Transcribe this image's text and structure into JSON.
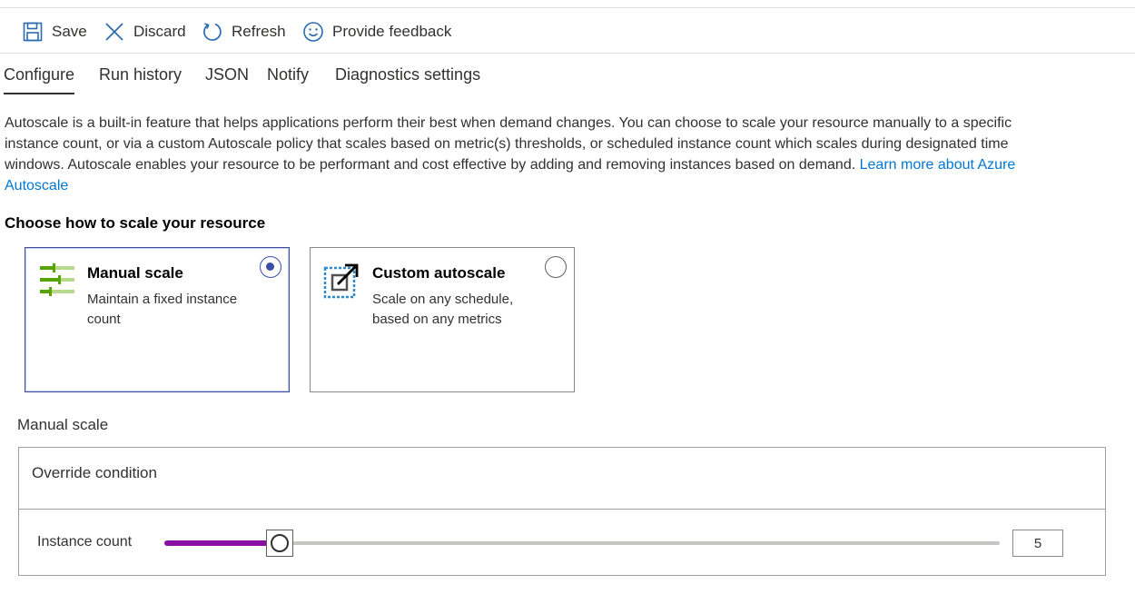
{
  "toolbar": {
    "save": {
      "label": "Save",
      "icon": "save-icon"
    },
    "discard": {
      "label": "Discard",
      "icon": "close-icon"
    },
    "refresh": {
      "label": "Refresh",
      "icon": "refresh-icon"
    },
    "feedback": {
      "label": "Provide feedback",
      "icon": "smiley-icon"
    }
  },
  "tabs": [
    {
      "label": "Configure",
      "active": true
    },
    {
      "label": "Run history",
      "active": false
    },
    {
      "label": "JSON",
      "active": false
    },
    {
      "label": "Notify",
      "active": false
    },
    {
      "label": "Diagnostics settings",
      "active": false
    }
  ],
  "description": {
    "text": "Autoscale is a built-in feature that helps applications perform their best when demand changes. You can choose to scale your resource manually to a specific instance count, or via a custom Autoscale policy that scales based on metric(s) thresholds, or scheduled instance count which scales during designated time windows. Autoscale enables your resource to be performant and cost effective by adding and removing instances based on demand.",
    "link": "Learn more about Azure Autoscale"
  },
  "scale_choice": {
    "title": "Choose how to scale your resource",
    "options": [
      {
        "title": "Manual scale",
        "description": "Maintain a fixed instance count",
        "selected": true,
        "icon": "manual-scale-icon"
      },
      {
        "title": "Custom autoscale",
        "description": "Scale on any schedule, based on any metrics",
        "selected": false,
        "icon": "custom-autoscale-icon"
      }
    ]
  },
  "manual_scale": {
    "section_label": "Manual scale",
    "override_label": "Override condition",
    "instance_count_label": "Instance count",
    "instance_count_value": "5",
    "slider_fraction": 0.137
  },
  "colors": {
    "accent": "#3b4fa8",
    "slider_fill": "#8b0fa6",
    "link": "#0078d4",
    "icon_blue": "#2b6cb0",
    "icon_green": "#57a300"
  }
}
